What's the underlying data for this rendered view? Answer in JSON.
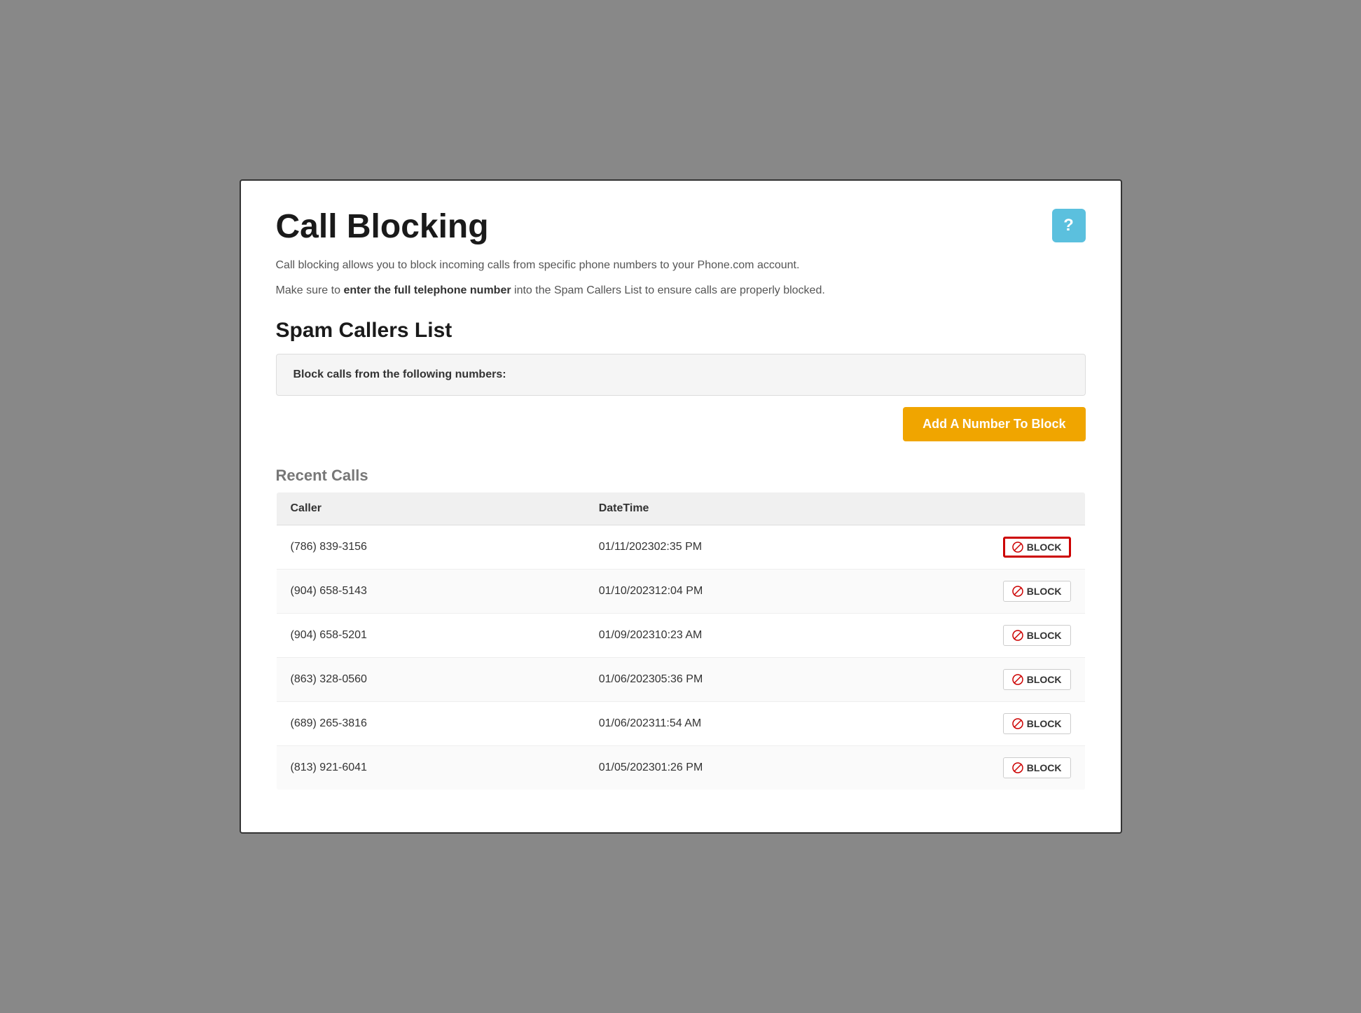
{
  "page": {
    "title": "Call Blocking",
    "help_button_label": "?",
    "description1": "Call blocking allows you to block incoming calls from specific phone numbers to your Phone.com account.",
    "description2_prefix": "Make sure to ",
    "description2_bold": "enter the full telephone number",
    "description2_suffix": " into the Spam Callers List to ensure calls are properly blocked.",
    "spam_section_title": "Spam Callers List",
    "spam_callers_label": "Block calls from the following numbers:",
    "add_button_label": "Add A Number To Block",
    "recent_calls_title": "Recent Calls",
    "table_headers": {
      "caller": "Caller",
      "datetime": "DateTime",
      "action": ""
    },
    "block_button_label": "BLOCK",
    "recent_calls": [
      {
        "caller": "(786) 839-3156",
        "datetime": "01/11/202302:35 PM",
        "highlighted": true
      },
      {
        "caller": "(904) 658-5143",
        "datetime": "01/10/202312:04 PM",
        "highlighted": false
      },
      {
        "caller": "(904) 658-5201",
        "datetime": "01/09/202310:23 AM",
        "highlighted": false
      },
      {
        "caller": "(863) 328-0560",
        "datetime": "01/06/202305:36 PM",
        "highlighted": false
      },
      {
        "caller": "(689) 265-3816",
        "datetime": "01/06/202311:54 AM",
        "highlighted": false
      },
      {
        "caller": "(813) 921-6041",
        "datetime": "01/05/202301:26 PM",
        "highlighted": false
      }
    ]
  }
}
